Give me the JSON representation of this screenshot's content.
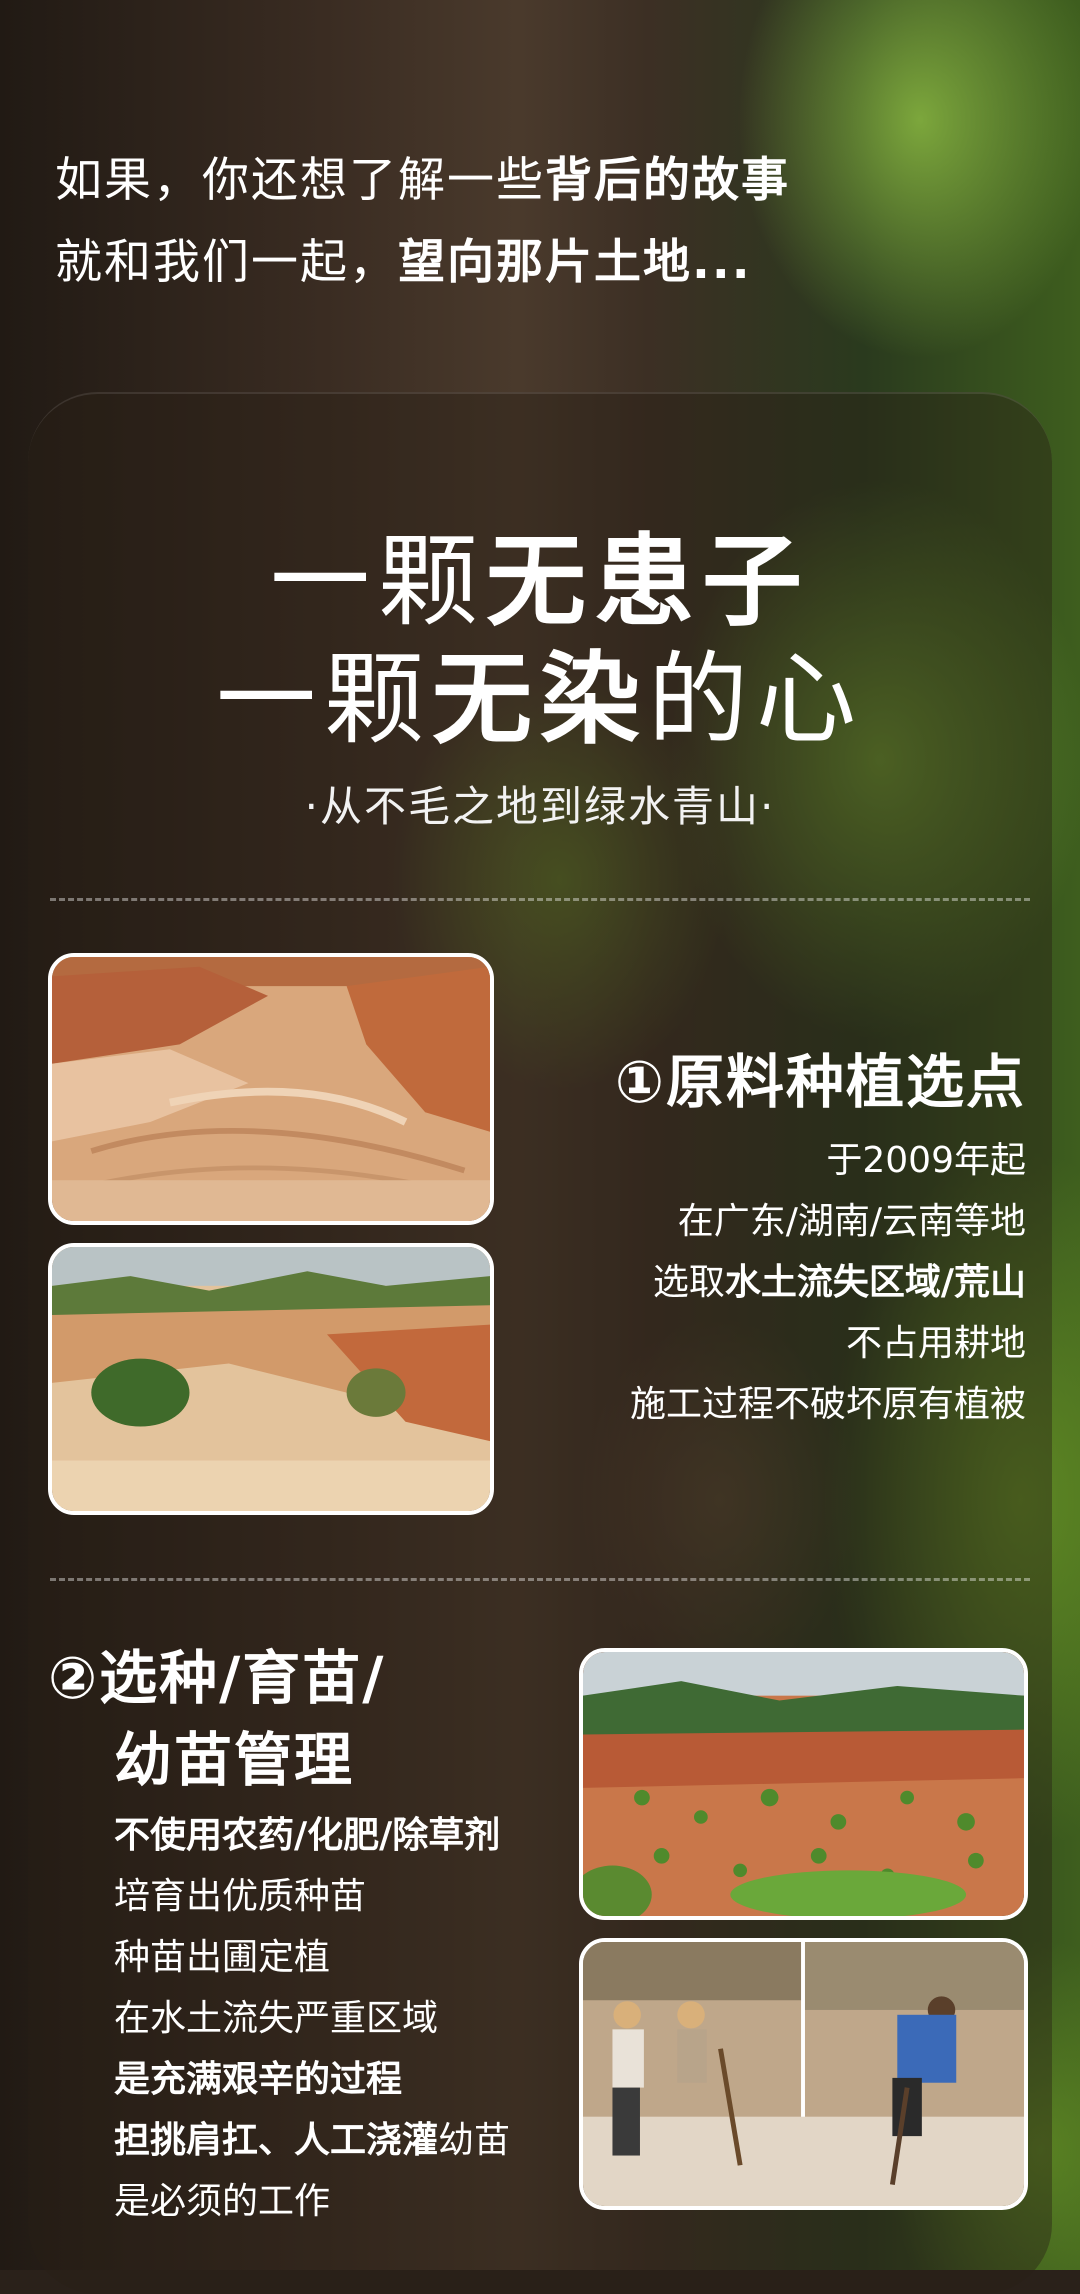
{
  "intro": {
    "line1_plain": "如果，你还想了解一些",
    "line1_bold": "背后的故事",
    "line2_plain": "就和我们一起，",
    "line2_bold": "望向那片土地..."
  },
  "headline": {
    "line1_plain": "一颗",
    "line1_bold": "无患子",
    "line2_plain_a": "一颗",
    "line2_bold": "无染",
    "line2_plain_b": "的心"
  },
  "subtitle": "·从不毛之地到绿水青山·",
  "section1": {
    "title": "①原料种植选点",
    "lines": [
      {
        "text": "于2009年起"
      },
      {
        "text": "在广东/湖南/云南等地"
      },
      {
        "pre": "选取",
        "bold": "水土流失区域/荒山"
      },
      {
        "text": "不占用耕地"
      },
      {
        "text": "施工过程不破坏原有植被"
      }
    ]
  },
  "section2": {
    "title_line1": "②选种/育苗/",
    "title_line2": "幼苗管理",
    "lines": [
      {
        "bold": "不使用农药/化肥/除草剂"
      },
      {
        "text": "培育出优质种苗"
      },
      {
        "text": "种苗出圃定植"
      },
      {
        "text": "在水土流失严重区域"
      },
      {
        "bold": "是充满艰辛的过程"
      },
      {
        "bold": "担挑肩扛、人工浇灌",
        "post": "幼苗"
      },
      {
        "text": "是必须的工作"
      }
    ]
  },
  "photos": [
    "eroded-red-land-photo",
    "barren-hills-photo",
    "planted-seedlings-photo",
    "workers-digging-photo"
  ],
  "colors": {
    "text": "#ffffff",
    "soil": "#c98a5a",
    "green": "#5f9a34"
  }
}
